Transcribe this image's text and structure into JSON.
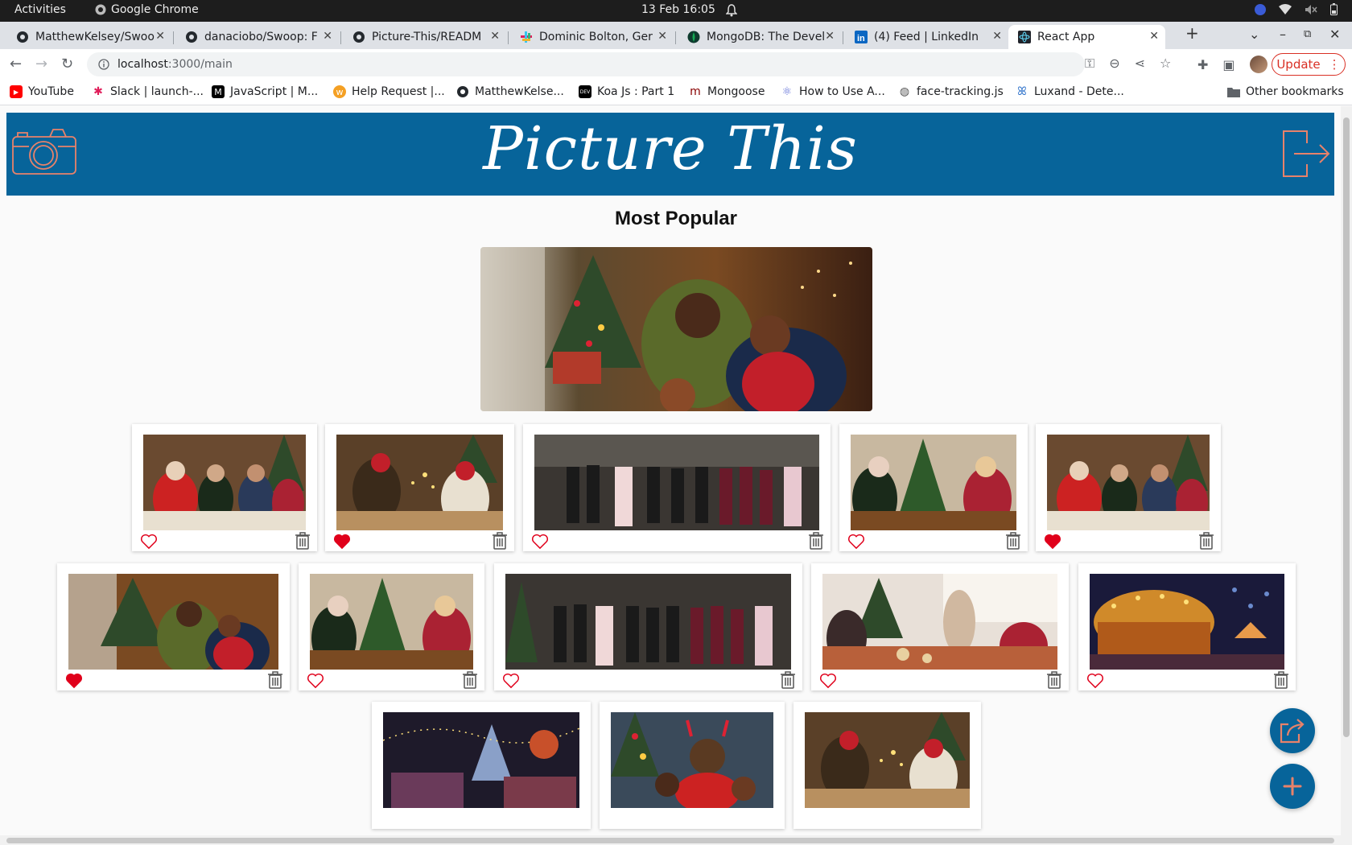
{
  "system_bar": {
    "activities": "Activities",
    "app_name": "Google Chrome",
    "clock": "13 Feb  16:05"
  },
  "browser": {
    "tabs": [
      {
        "title": "MatthewKelsey/Swoo",
        "icon": "github-icon"
      },
      {
        "title": "danaciobo/Swoop: F",
        "icon": "github-icon"
      },
      {
        "title": "Picture-This/READM",
        "icon": "github-icon"
      },
      {
        "title": "Dominic Bolton, Ger",
        "icon": "slack-icon"
      },
      {
        "title": "MongoDB: The Devel",
        "icon": "mongodb-icon"
      },
      {
        "title": "(4) Feed | LinkedIn",
        "icon": "linkedin-icon"
      },
      {
        "title": "React App",
        "icon": "react-icon",
        "active": true
      }
    ],
    "url_host": "localhost",
    "url_rest": ":3000/main",
    "update_label": "Update",
    "bookmarks": [
      {
        "label": "YouTube",
        "icon": "youtube-icon",
        "color": "#ff0000"
      },
      {
        "label": "Slack | launch-...",
        "icon": "slack-icon",
        "color": "#e01e5a"
      },
      {
        "label": "JavaScript | M...",
        "icon": "mdn-icon",
        "color": "#000000"
      },
      {
        "label": "Help Request |...",
        "icon": "help-icon",
        "color": "#f4a024"
      },
      {
        "label": "MatthewKelse...",
        "icon": "github-icon",
        "color": "#24292e"
      },
      {
        "label": "Koa Js : Part 1",
        "icon": "dev-icon",
        "color": "#000000"
      },
      {
        "label": "Mongoose",
        "icon": "mongoose-icon",
        "color": "#880000"
      },
      {
        "label": "How to Use A...",
        "icon": "react-icon",
        "color": "#5b6bd6"
      },
      {
        "label": "face-tracking.js",
        "icon": "globe-icon",
        "color": "#555555"
      },
      {
        "label": "Luxand - Dete...",
        "icon": "luxand-icon",
        "color": "#2a6fc9"
      }
    ],
    "other_bookmarks": "Other bookmarks"
  },
  "app": {
    "logo_text": "Picture This",
    "section_title": "Most Popular",
    "brand_color": "#07649a",
    "accent_color": "#e8826a",
    "like_color": "#e0001b",
    "hero_photo": "family-christmas-tree",
    "rows": [
      [
        {
          "photo": "family-dinner-santa-hats",
          "liked": false
        },
        {
          "photo": "sparklers-dinner",
          "liked": true
        },
        {
          "photo": "choir-church",
          "liked": false
        },
        {
          "photo": "grandparents-dinner",
          "liked": false
        },
        {
          "photo": "family-dinner-santa-hats",
          "liked": true
        }
      ],
      [
        {
          "photo": "family-christmas-tree",
          "liked": true
        },
        {
          "photo": "grandparents-dinner",
          "liked": false
        },
        {
          "photo": "choir-church",
          "liked": false
        },
        {
          "photo": "party-table",
          "liked": false
        },
        {
          "photo": "carousel-night",
          "liked": false
        }
      ],
      [
        {
          "photo": "christmas-market",
          "liked": false
        },
        {
          "photo": "reindeer-antlers-family",
          "liked": false
        },
        {
          "photo": "sparklers-dinner",
          "liked": false
        }
      ]
    ]
  }
}
